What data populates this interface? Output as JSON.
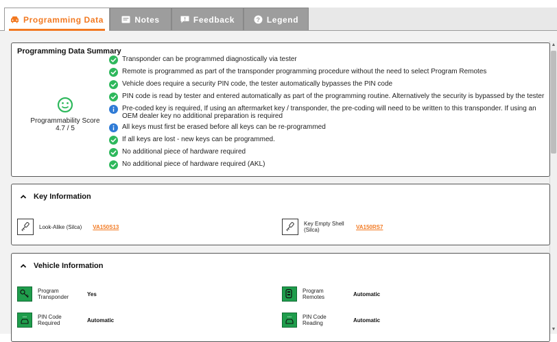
{
  "tabs": [
    {
      "label": "Programming Data",
      "icon": "car-icon",
      "active": true
    },
    {
      "label": "Notes",
      "icon": "notes-icon",
      "active": false
    },
    {
      "label": "Feedback",
      "icon": "feedback-icon",
      "active": false
    },
    {
      "label": "Legend",
      "icon": "help-icon",
      "active": false
    }
  ],
  "colors": {
    "accent": "#f27921",
    "success": "#2eb85c",
    "info": "#2f7bd6",
    "vehicle_icon": "#1f9d4c"
  },
  "summary": {
    "title": "Programming Data Summary",
    "score_label": "Programmability Score",
    "score_value": "4.7 / 5",
    "items": [
      {
        "status": "check",
        "text": "Transponder can be programmed diagnostically via tester"
      },
      {
        "status": "check",
        "text": "Remote is programmed as part of the transponder programming procedure without the need to select Program Remotes"
      },
      {
        "status": "check",
        "text": "Vehicle does require a security PIN code, the tester automatically bypasses the PIN code"
      },
      {
        "status": "check",
        "text": "PIN code is read by tester and entered automatically as part of the programming routine. Alternatively the security is bypassed by the tester"
      },
      {
        "status": "info",
        "text": "Pre-coded key is required, If using an aftermarket key / transponder, the pre-coding will need to be written to this transponder. If using an OEM dealer key no additional preparation is required"
      },
      {
        "status": "info",
        "text": "All keys must first be erased before all keys can be re-programmed"
      },
      {
        "status": "check",
        "text": "If all keys are lost - new keys can be programmed."
      },
      {
        "status": "check",
        "text": "No additional piece of hardware required"
      },
      {
        "status": "check",
        "text": "No additional piece of hardware required (AKL)"
      }
    ]
  },
  "key_info": {
    "title": "Key Information",
    "items": [
      {
        "label": "Look-Alike (Silca)",
        "link": "VA150S13",
        "icon": "key-icon"
      },
      {
        "label": "Key Empty Shell (Silca)",
        "link": "VA150RS7",
        "icon": "key-icon"
      }
    ]
  },
  "vehicle_info": {
    "title": "Vehicle Information",
    "items": [
      {
        "label": "Program Transponder",
        "value": "Yes",
        "icon": "transponder-icon"
      },
      {
        "label": "Program Remotes",
        "value": "Automatic",
        "icon": "remote-icon"
      },
      {
        "label": "PIN Code Required",
        "value": "Automatic",
        "icon": "pin-car-icon"
      },
      {
        "label": "PIN Code Reading",
        "value": "Automatic",
        "icon": "pin-car-icon"
      }
    ]
  }
}
